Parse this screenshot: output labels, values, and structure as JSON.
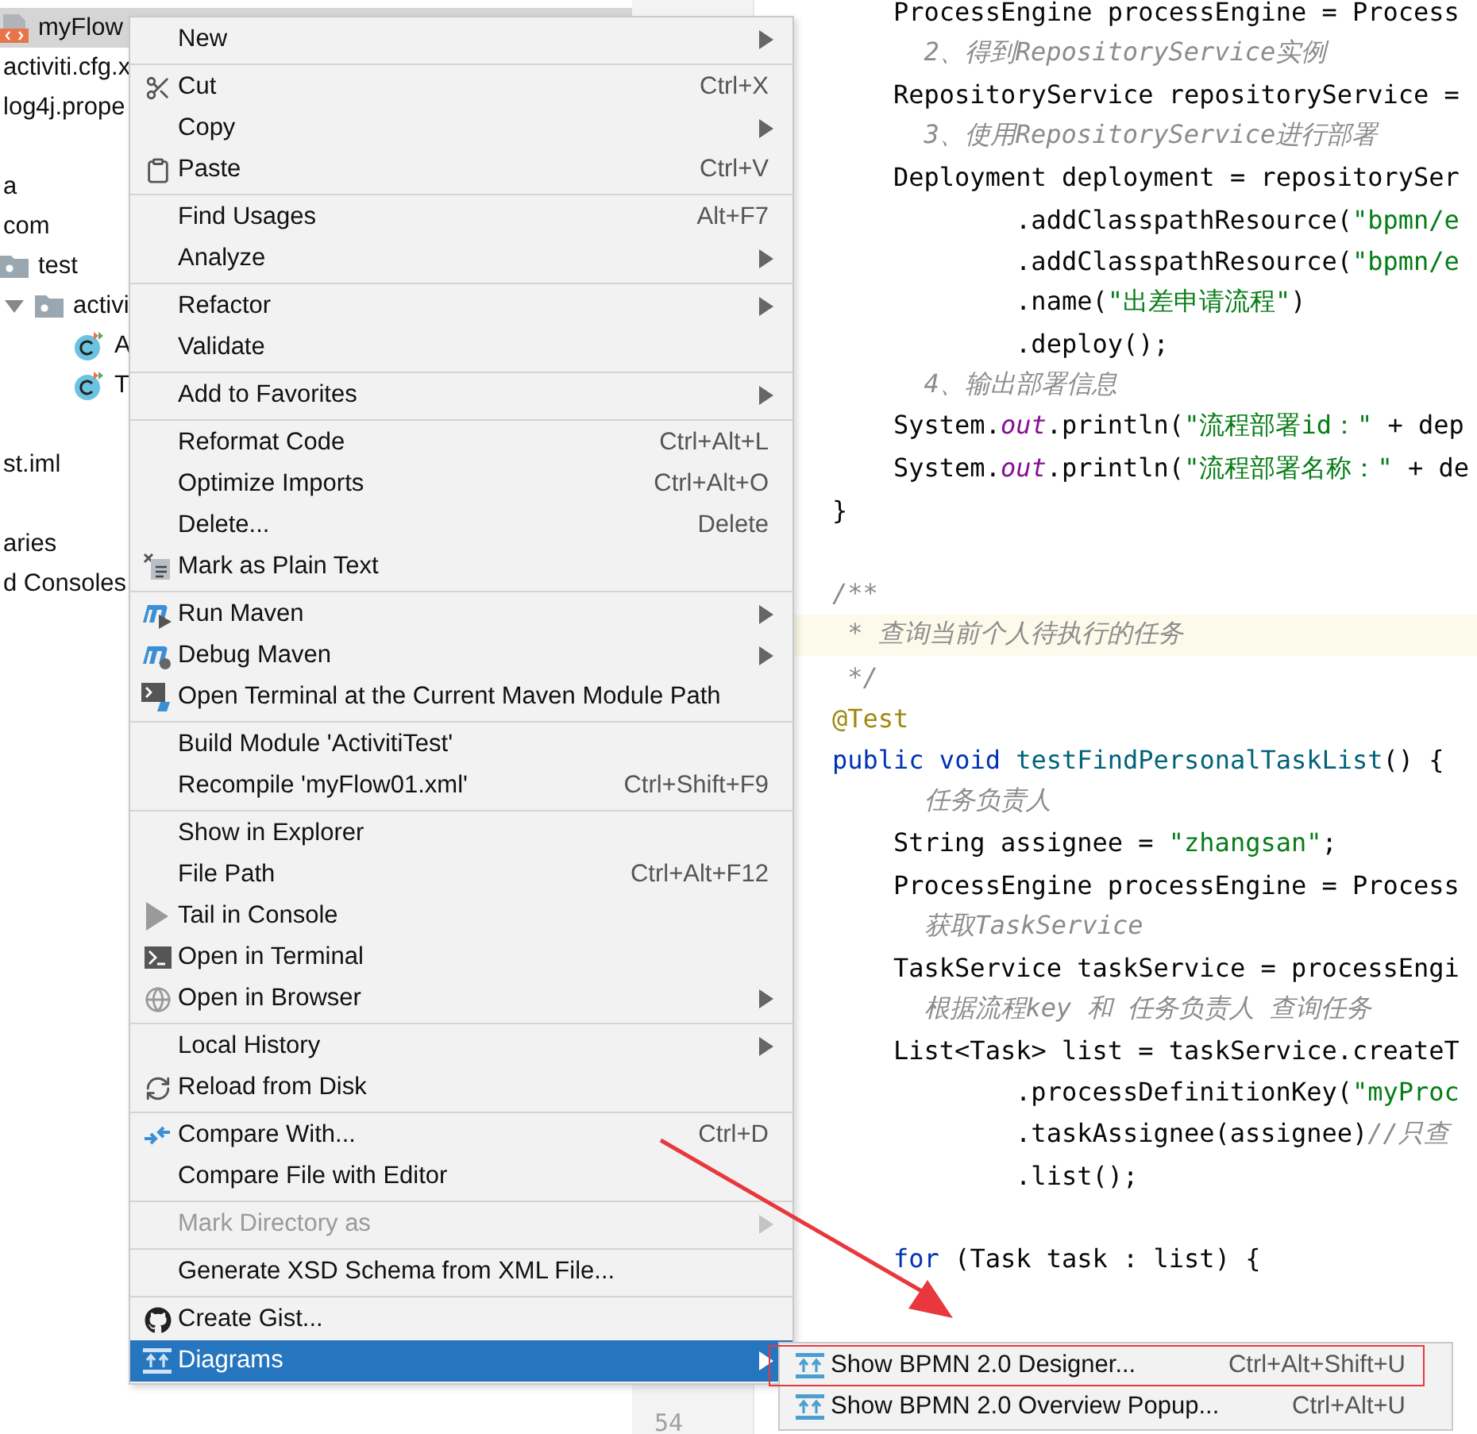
{
  "project_tree": {
    "items": [
      {
        "kind": "xml-file",
        "label": "myFlow",
        "selected": true
      },
      {
        "kind": "file",
        "label": "activiti.cfg.x",
        "selected": false
      },
      {
        "kind": "file",
        "label": "log4j.prope",
        "selected": false
      },
      {
        "kind": "covered"
      },
      {
        "kind": "file",
        "label": "a",
        "selected": false
      },
      {
        "kind": "file",
        "label": "com",
        "selected": false
      },
      {
        "kind": "folder",
        "label": "test",
        "selected": false,
        "children": [
          {
            "kind": "folder",
            "label": "activi",
            "selected": false,
            "expanded": true,
            "children": [
              {
                "kind": "class",
                "label": "A",
                "selected": false
              },
              {
                "kind": "class",
                "label": "T",
                "selected": false
              }
            ]
          }
        ]
      },
      {
        "kind": "covered"
      },
      {
        "kind": "file",
        "label": "st.iml",
        "selected": false
      },
      {
        "kind": "covered"
      },
      {
        "kind": "file",
        "label": "aries",
        "selected": false
      },
      {
        "kind": "file",
        "label": "d Consoles",
        "selected": false
      }
    ]
  },
  "gutter": {
    "line_numbers": [
      "54"
    ]
  },
  "editor": {
    "lines": [
      {
        "kind": "statement",
        "current": false,
        "segments": [
          {
            "kind": "plain",
            "text": "ProcessEngine processEngine = Process"
          }
        ]
      },
      {
        "kind": "comment",
        "current": false,
        "segments": [
          {
            "kind": "comment",
            "text": "2、得到RepositoryService实例"
          }
        ]
      },
      {
        "kind": "statement",
        "current": false,
        "segments": [
          {
            "kind": "plain",
            "text": "RepositoryService repositoryService ="
          }
        ]
      },
      {
        "kind": "comment",
        "current": false,
        "segments": [
          {
            "kind": "comment",
            "text": "3、使用RepositoryService进行部署"
          }
        ]
      },
      {
        "kind": "statement",
        "current": false,
        "segments": [
          {
            "kind": "plain",
            "text": "Deployment deployment = repositorySer"
          }
        ]
      },
      {
        "kind": "continuation",
        "current": false,
        "segments": [
          {
            "kind": "plain",
            "text": ".addClasspathResource("
          },
          {
            "kind": "string",
            "text": "\"bpmn/e"
          }
        ]
      },
      {
        "kind": "continuation",
        "current": false,
        "segments": [
          {
            "kind": "plain",
            "text": ".addClasspathResource("
          },
          {
            "kind": "string",
            "text": "\"bpmn/e"
          }
        ]
      },
      {
        "kind": "continuation",
        "current": false,
        "segments": [
          {
            "kind": "plain",
            "text": ".name("
          },
          {
            "kind": "string",
            "text": "\"出差申请流程\""
          },
          {
            "kind": "plain",
            "text": ")"
          }
        ]
      },
      {
        "kind": "continuation",
        "current": false,
        "segments": [
          {
            "kind": "plain",
            "text": ".deploy();"
          }
        ]
      },
      {
        "kind": "comment",
        "current": false,
        "segments": [
          {
            "kind": "comment",
            "text": "4、输出部署信息"
          }
        ]
      },
      {
        "kind": "statement",
        "current": false,
        "segments": [
          {
            "kind": "plain",
            "text": "System."
          },
          {
            "kind": "field",
            "text": "out"
          },
          {
            "kind": "plain",
            "text": ".println("
          },
          {
            "kind": "string",
            "text": "\"流程部署id：\""
          },
          {
            "kind": "plain",
            "text": " + dep"
          }
        ]
      },
      {
        "kind": "statement",
        "current": false,
        "segments": [
          {
            "kind": "plain",
            "text": "System."
          },
          {
            "kind": "field",
            "text": "out"
          },
          {
            "kind": "plain",
            "text": ".println("
          },
          {
            "kind": "string",
            "text": "\"流程部署名称：\""
          },
          {
            "kind": "plain",
            "text": " + de"
          }
        ]
      },
      {
        "kind": "top",
        "current": false,
        "segments": [
          {
            "kind": "plain",
            "text": "}"
          }
        ]
      },
      {
        "kind": "blank",
        "current": false
      },
      {
        "kind": "top",
        "current": false,
        "segments": [
          {
            "kind": "comment",
            "text": "/**"
          }
        ]
      },
      {
        "kind": "doc",
        "current": true,
        "segments": [
          {
            "kind": "comment",
            "text": "* 查询当前个人待执行的任务"
          }
        ]
      },
      {
        "kind": "doc",
        "current": false,
        "segments": [
          {
            "kind": "comment",
            "text": "*/"
          }
        ]
      },
      {
        "kind": "top",
        "current": false,
        "segments": [
          {
            "kind": "annotation",
            "text": "@Test"
          }
        ]
      },
      {
        "kind": "top",
        "current": false,
        "segments": [
          {
            "kind": "keyword",
            "text": "public void "
          },
          {
            "kind": "method",
            "text": "testFindPersonalTaskList"
          },
          {
            "kind": "plain",
            "text": "() {"
          }
        ]
      },
      {
        "kind": "comment",
        "current": false,
        "segments": [
          {
            "kind": "comment",
            "text": "任务负责人"
          }
        ]
      },
      {
        "kind": "statement",
        "current": false,
        "segments": [
          {
            "kind": "plain",
            "text": "String assignee = "
          },
          {
            "kind": "string",
            "text": "\"zhangsan\""
          },
          {
            "kind": "plain",
            "text": ";"
          }
        ]
      },
      {
        "kind": "statement",
        "current": false,
        "segments": [
          {
            "kind": "plain",
            "text": "ProcessEngine processEngine = Process"
          }
        ]
      },
      {
        "kind": "comment",
        "current": false,
        "segments": [
          {
            "kind": "comment",
            "text": "获取TaskService"
          }
        ]
      },
      {
        "kind": "statement",
        "current": false,
        "segments": [
          {
            "kind": "plain",
            "text": "TaskService taskService = processEngi"
          }
        ]
      },
      {
        "kind": "comment",
        "current": false,
        "segments": [
          {
            "kind": "comment",
            "text": "根据流程key 和 任务负责人 查询任务"
          }
        ]
      },
      {
        "kind": "statement",
        "current": false,
        "segments": [
          {
            "kind": "plain",
            "text": "List<Task> list = taskService.createT"
          }
        ]
      },
      {
        "kind": "continuation",
        "current": false,
        "segments": [
          {
            "kind": "plain",
            "text": ".processDefinitionKey("
          },
          {
            "kind": "string",
            "text": "\"myProc"
          }
        ]
      },
      {
        "kind": "continuation",
        "current": false,
        "segments": [
          {
            "kind": "plain",
            "text": ".taskAssignee(assignee)"
          },
          {
            "kind": "comment",
            "text": "//只查"
          }
        ]
      },
      {
        "kind": "continuation",
        "current": false,
        "segments": [
          {
            "kind": "plain",
            "text": ".list();"
          }
        ]
      },
      {
        "kind": "blank",
        "current": false
      },
      {
        "kind": "statement",
        "current": false,
        "segments": [
          {
            "kind": "keyword",
            "text": "for"
          },
          {
            "kind": "plain",
            "text": " (Task task : list) {"
          }
        ]
      }
    ]
  },
  "context_menu": {
    "groups": [
      {
        "items": [
          {
            "label": "New",
            "submenu": true,
            "disabled": false,
            "selected": false
          }
        ]
      },
      {
        "items": [
          {
            "label": "Cut",
            "shortcut": "Ctrl+X",
            "submenu": false,
            "disabled": false,
            "selected": false
          },
          {
            "label": "Copy",
            "submenu": true,
            "disabled": false,
            "selected": false
          },
          {
            "label": "Paste",
            "shortcut": "Ctrl+V",
            "submenu": false,
            "disabled": false,
            "selected": false
          }
        ]
      },
      {
        "items": [
          {
            "label": "Find Usages",
            "shortcut": "Alt+F7",
            "submenu": false,
            "disabled": false,
            "selected": false
          },
          {
            "label": "Analyze",
            "submenu": true,
            "disabled": false,
            "selected": false
          }
        ]
      },
      {
        "items": [
          {
            "label": "Refactor",
            "submenu": true,
            "disabled": false,
            "selected": false
          },
          {
            "label": "Validate",
            "submenu": false,
            "disabled": false,
            "selected": false
          }
        ]
      },
      {
        "items": [
          {
            "label": "Add to Favorites",
            "submenu": true,
            "disabled": false,
            "selected": false
          }
        ]
      },
      {
        "items": [
          {
            "label": "Reformat Code",
            "shortcut": "Ctrl+Alt+L",
            "submenu": false,
            "disabled": false,
            "selected": false
          },
          {
            "label": "Optimize Imports",
            "shortcut": "Ctrl+Alt+O",
            "submenu": false,
            "disabled": false,
            "selected": false
          },
          {
            "label": "Delete...",
            "shortcut": "Delete",
            "submenu": false,
            "disabled": false,
            "selected": false
          },
          {
            "label": "Mark as Plain Text",
            "submenu": false,
            "disabled": false,
            "selected": false
          }
        ]
      },
      {
        "items": [
          {
            "label": "Run Maven",
            "submenu": true,
            "disabled": false,
            "selected": false
          },
          {
            "label": "Debug Maven",
            "submenu": true,
            "disabled": false,
            "selected": false
          },
          {
            "label": "Open Terminal at the Current Maven Module Path",
            "submenu": false,
            "disabled": false,
            "selected": false
          }
        ]
      },
      {
        "items": [
          {
            "label": "Build Module 'ActivitiTest'",
            "submenu": false,
            "disabled": false,
            "selected": false
          },
          {
            "label": "Recompile 'myFlow01.xml'",
            "shortcut": "Ctrl+Shift+F9",
            "submenu": false,
            "disabled": false,
            "selected": false
          }
        ]
      },
      {
        "items": [
          {
            "label": "Show in Explorer",
            "submenu": false,
            "disabled": false,
            "selected": false
          },
          {
            "label": "File Path",
            "shortcut": "Ctrl+Alt+F12",
            "submenu": false,
            "disabled": false,
            "selected": false
          },
          {
            "label": "Tail in Console",
            "submenu": false,
            "disabled": false,
            "selected": false
          },
          {
            "label": "Open in Terminal",
            "submenu": false,
            "disabled": false,
            "selected": false
          },
          {
            "label": "Open in Browser",
            "submenu": true,
            "disabled": false,
            "selected": false
          }
        ]
      },
      {
        "items": [
          {
            "label": "Local History",
            "submenu": true,
            "disabled": false,
            "selected": false
          },
          {
            "label": "Reload from Disk",
            "submenu": false,
            "disabled": false,
            "selected": false
          }
        ]
      },
      {
        "items": [
          {
            "label": "Compare With...",
            "shortcut": "Ctrl+D",
            "submenu": false,
            "disabled": false,
            "selected": false
          },
          {
            "label": "Compare File with Editor",
            "submenu": false,
            "disabled": false,
            "selected": false
          }
        ]
      },
      {
        "items": [
          {
            "label": "Mark Directory as",
            "submenu": true,
            "disabled": true,
            "selected": false
          }
        ]
      },
      {
        "items": [
          {
            "label": "Generate XSD Schema from XML File...",
            "submenu": false,
            "disabled": false,
            "selected": false
          }
        ]
      },
      {
        "items": [
          {
            "label": "Create Gist...",
            "submenu": false,
            "disabled": false,
            "selected": false
          },
          {
            "label": "Diagrams",
            "submenu": true,
            "disabled": false,
            "selected": true
          }
        ]
      }
    ]
  },
  "submenu": {
    "items": [
      {
        "label": "Show BPMN 2.0 Designer...",
        "shortcut": "Ctrl+Alt+Shift+U",
        "highlighted": true
      },
      {
        "label": "Show BPMN 2.0 Overview Popup...",
        "shortcut": "Ctrl+Alt+U",
        "highlighted": false
      }
    ]
  },
  "annotation": {
    "arrow": true
  }
}
